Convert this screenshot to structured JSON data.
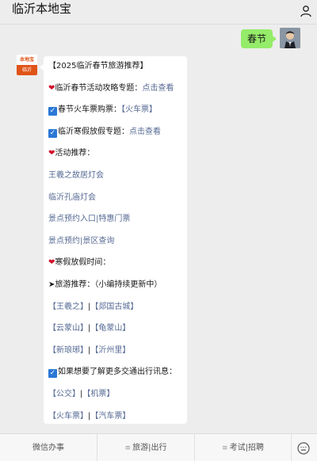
{
  "header": {
    "title": "临沂本地宝",
    "profile_icon": "person-icon"
  },
  "outgoing": {
    "text": "春节"
  },
  "incoming": {
    "avatar_top": "本地宝",
    "avatar_bottom": "临沂",
    "lines": [
      {
        "prefix": "",
        "text": "【2025临沂春节旅游推荐】",
        "link": "",
        "suffix": ""
      },
      {
        "prefix": "heart",
        "text": "临沂春节活动攻略专题：",
        "link": "点击查看",
        "suffix": ""
      },
      {
        "prefix": "check",
        "text": "春节火车票购票：",
        "link": "【火车票】",
        "suffix": ""
      },
      {
        "prefix": "check",
        "text": "临沂寒假放假专题：",
        "link": "点击查看",
        "suffix": ""
      },
      {
        "prefix": "heart",
        "text": "活动推荐：",
        "link": "",
        "suffix": ""
      },
      {
        "prefix": "",
        "text": "",
        "link": "王羲之故居灯会",
        "suffix": ""
      },
      {
        "prefix": "",
        "text": "",
        "link": "临沂孔庙灯会",
        "suffix": ""
      },
      {
        "prefix": "",
        "text": "",
        "link": "景点预约入口|特惠门票",
        "suffix": ""
      },
      {
        "prefix": "",
        "text": "",
        "link": "景点预约|景区查询",
        "suffix": ""
      },
      {
        "prefix": "heart",
        "text": "寒假放假时间：",
        "link": "",
        "suffix": ""
      },
      {
        "prefix": "arrow",
        "text": "旅游推荐：（小编持续更新中）",
        "link": "",
        "suffix": ""
      },
      {
        "prefix": "",
        "text": "",
        "link": "【王羲之】",
        "sep": "|",
        "link2": "【郯国古城】"
      },
      {
        "prefix": "",
        "text": "",
        "link": "【云蒙山】",
        "sep": "|",
        "link2": "【龟蒙山】"
      },
      {
        "prefix": "",
        "text": "",
        "link": "【新琅琊】",
        "sep": "|",
        "link2": "【沂州里】"
      },
      {
        "prefix": "check",
        "text": "如果想要了解更多交通出行讯息：",
        "link": "",
        "suffix": ""
      },
      {
        "prefix": "",
        "text": "",
        "link": "【公交】",
        "sep": "|",
        "link2": "【机票】"
      },
      {
        "prefix": "",
        "text": "",
        "link": "【火车票】",
        "sep": "|",
        "link2": "【汽车票】"
      }
    ]
  },
  "bottom_menu": {
    "items": [
      "微信办事",
      "旅游|出行",
      "考试|招聘"
    ],
    "keyboard_icon": "keyboard-icon"
  }
}
